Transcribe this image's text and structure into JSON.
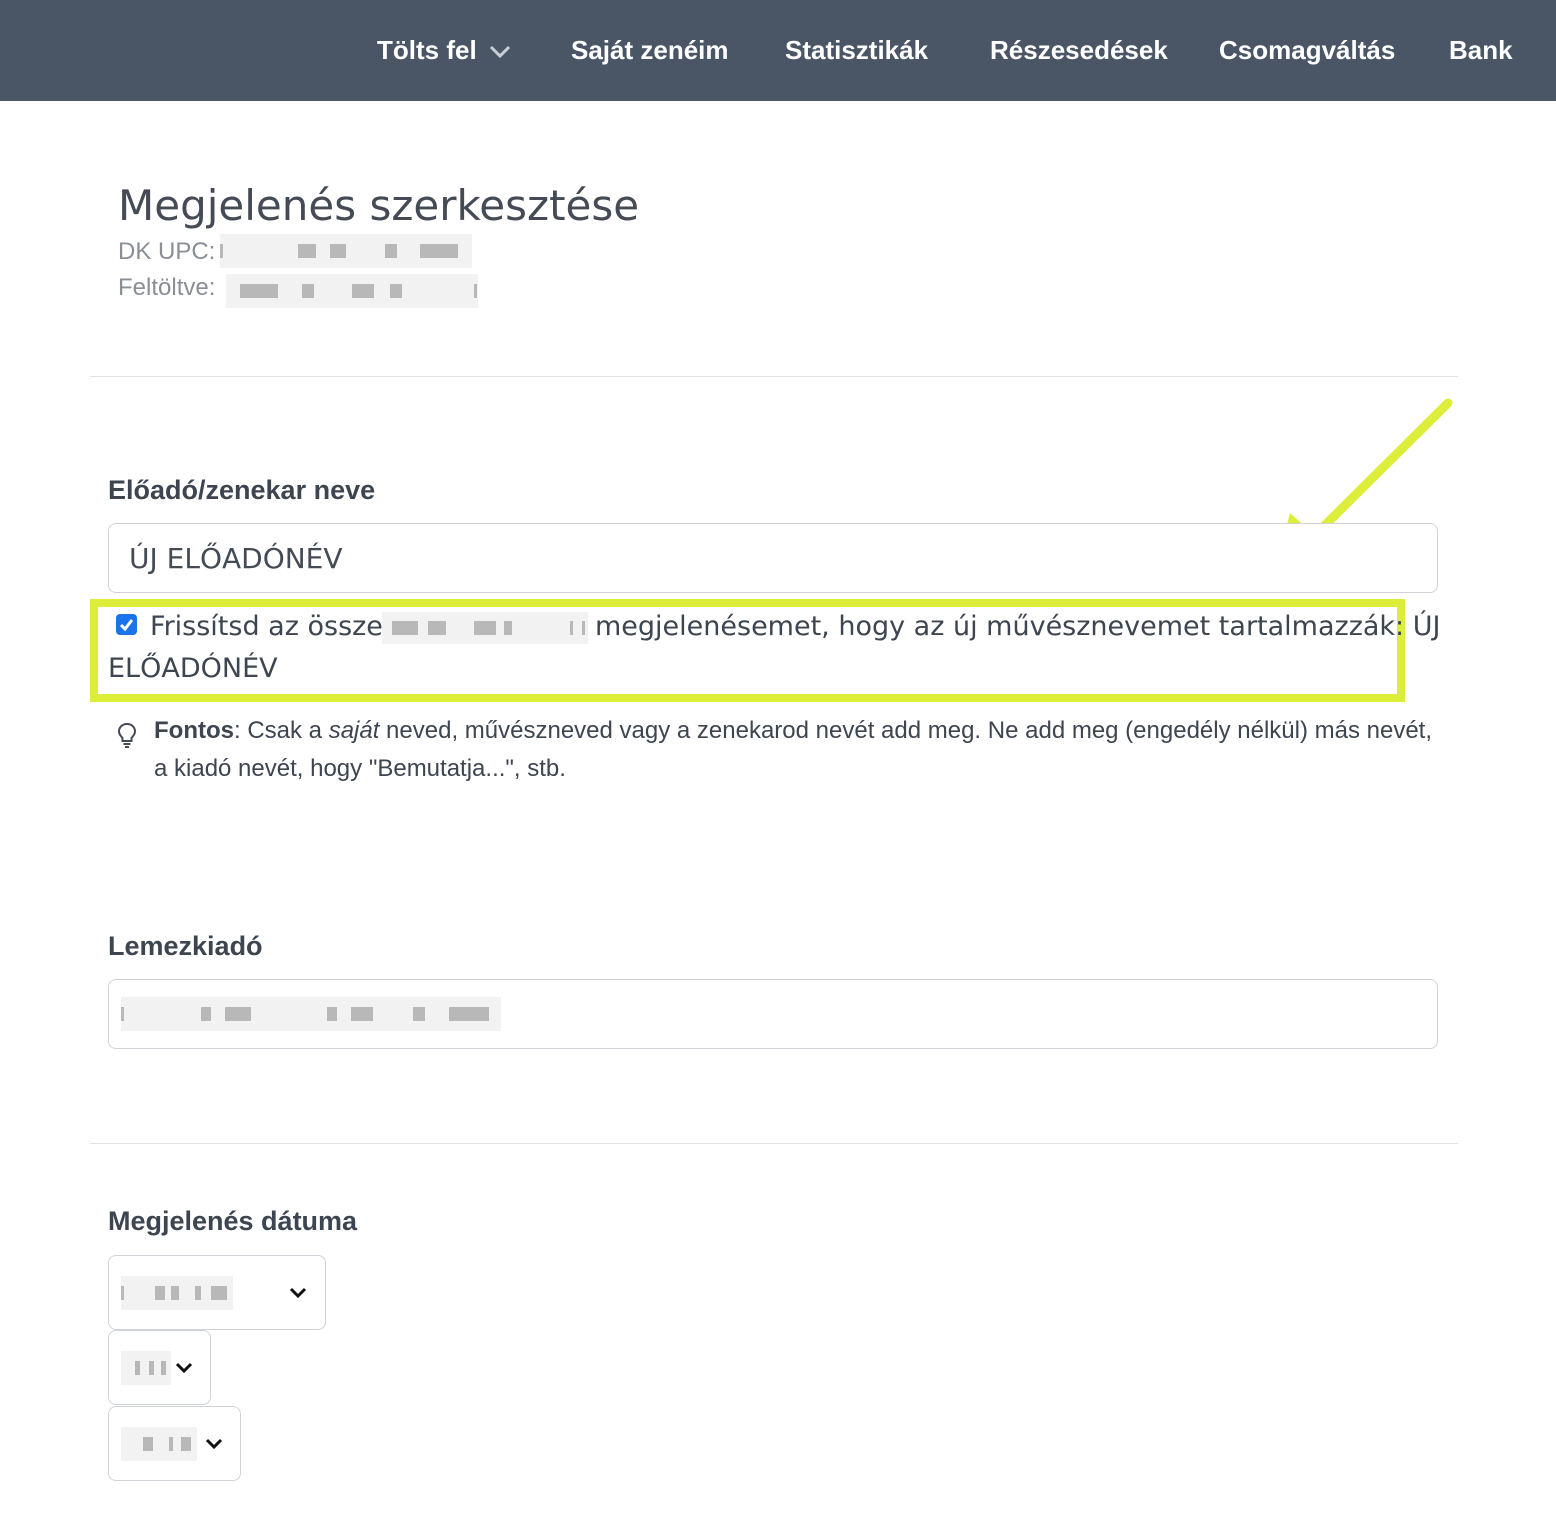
{
  "nav": {
    "items": [
      {
        "label": "Tölts fel",
        "has_dropdown": true
      },
      {
        "label": "Saját zenéim"
      },
      {
        "label": "Statisztikák"
      },
      {
        "label": "Részesedések"
      },
      {
        "label": "Csomagváltás"
      },
      {
        "label": "Bank"
      }
    ],
    "bg_color": "#4a5565"
  },
  "page": {
    "title": "Megjelenés szerkesztése",
    "upc_label": "DK UPC:",
    "uploaded_label": "Feltöltve:"
  },
  "artist_field": {
    "label": "Előadó/zenekar neve",
    "value": "ÚJ ELŐADÓNÉV",
    "update_checkbox": {
      "checked": true,
      "text_before": "Frissítsd az összes",
      "text_after": "megjelenésemet, hogy az új művésznevemet tartalmazzák: ÚJ",
      "text_line2": "ELŐADÓNÉV"
    },
    "tip": {
      "strong": "Fontos",
      "part1": ": Csak a ",
      "emphasis": "saját",
      "part2": " neved, művészneved vagy a zenekarod nevét add meg. Ne add meg (engedély nélkül) más nevét, a kiadó nevét, hogy \"Bemutatja...\", stb."
    }
  },
  "label_field": {
    "label": "Lemezkiadó"
  },
  "date_field": {
    "label": "Megjelenés dátuma"
  },
  "annotation": {
    "highlight_color": "#dcee3a",
    "arrow_color": "#dcee3a"
  }
}
